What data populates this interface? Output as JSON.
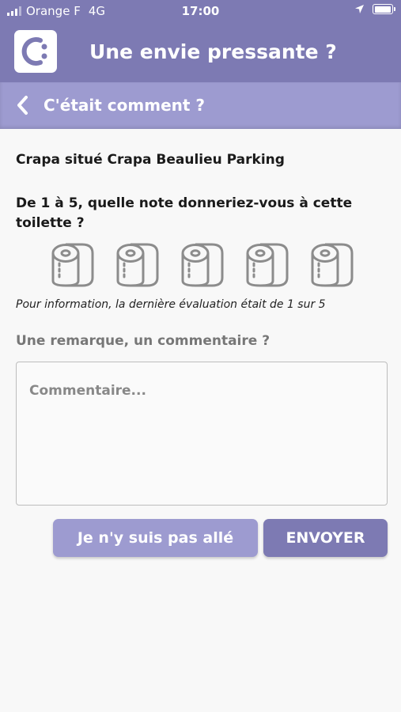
{
  "status_bar": {
    "carrier": "Orange F",
    "network": "4G",
    "time": "17:00"
  },
  "header": {
    "title": "Une envie pressante ?"
  },
  "subheader": {
    "title": "C'était comment ?"
  },
  "location": {
    "text": "Crapa situé Crapa Beaulieu Parking"
  },
  "rating": {
    "question": "De 1 à 5, quelle note donneriez-vous à cette toilette ?",
    "max": 5,
    "selected": 0,
    "info": "Pour information, la dernière évaluation était de 1 sur 5"
  },
  "comment": {
    "label": "Une remarque, un commentaire ?",
    "placeholder": "Commentaire...",
    "value": ""
  },
  "buttons": {
    "skip_label": "Je n'y suis pas allé",
    "send_label": "ENVOYER"
  },
  "colors": {
    "primary": "#7d7ab3",
    "secondary": "#9d9bd0",
    "icon_gray": "#8c8c8c"
  }
}
